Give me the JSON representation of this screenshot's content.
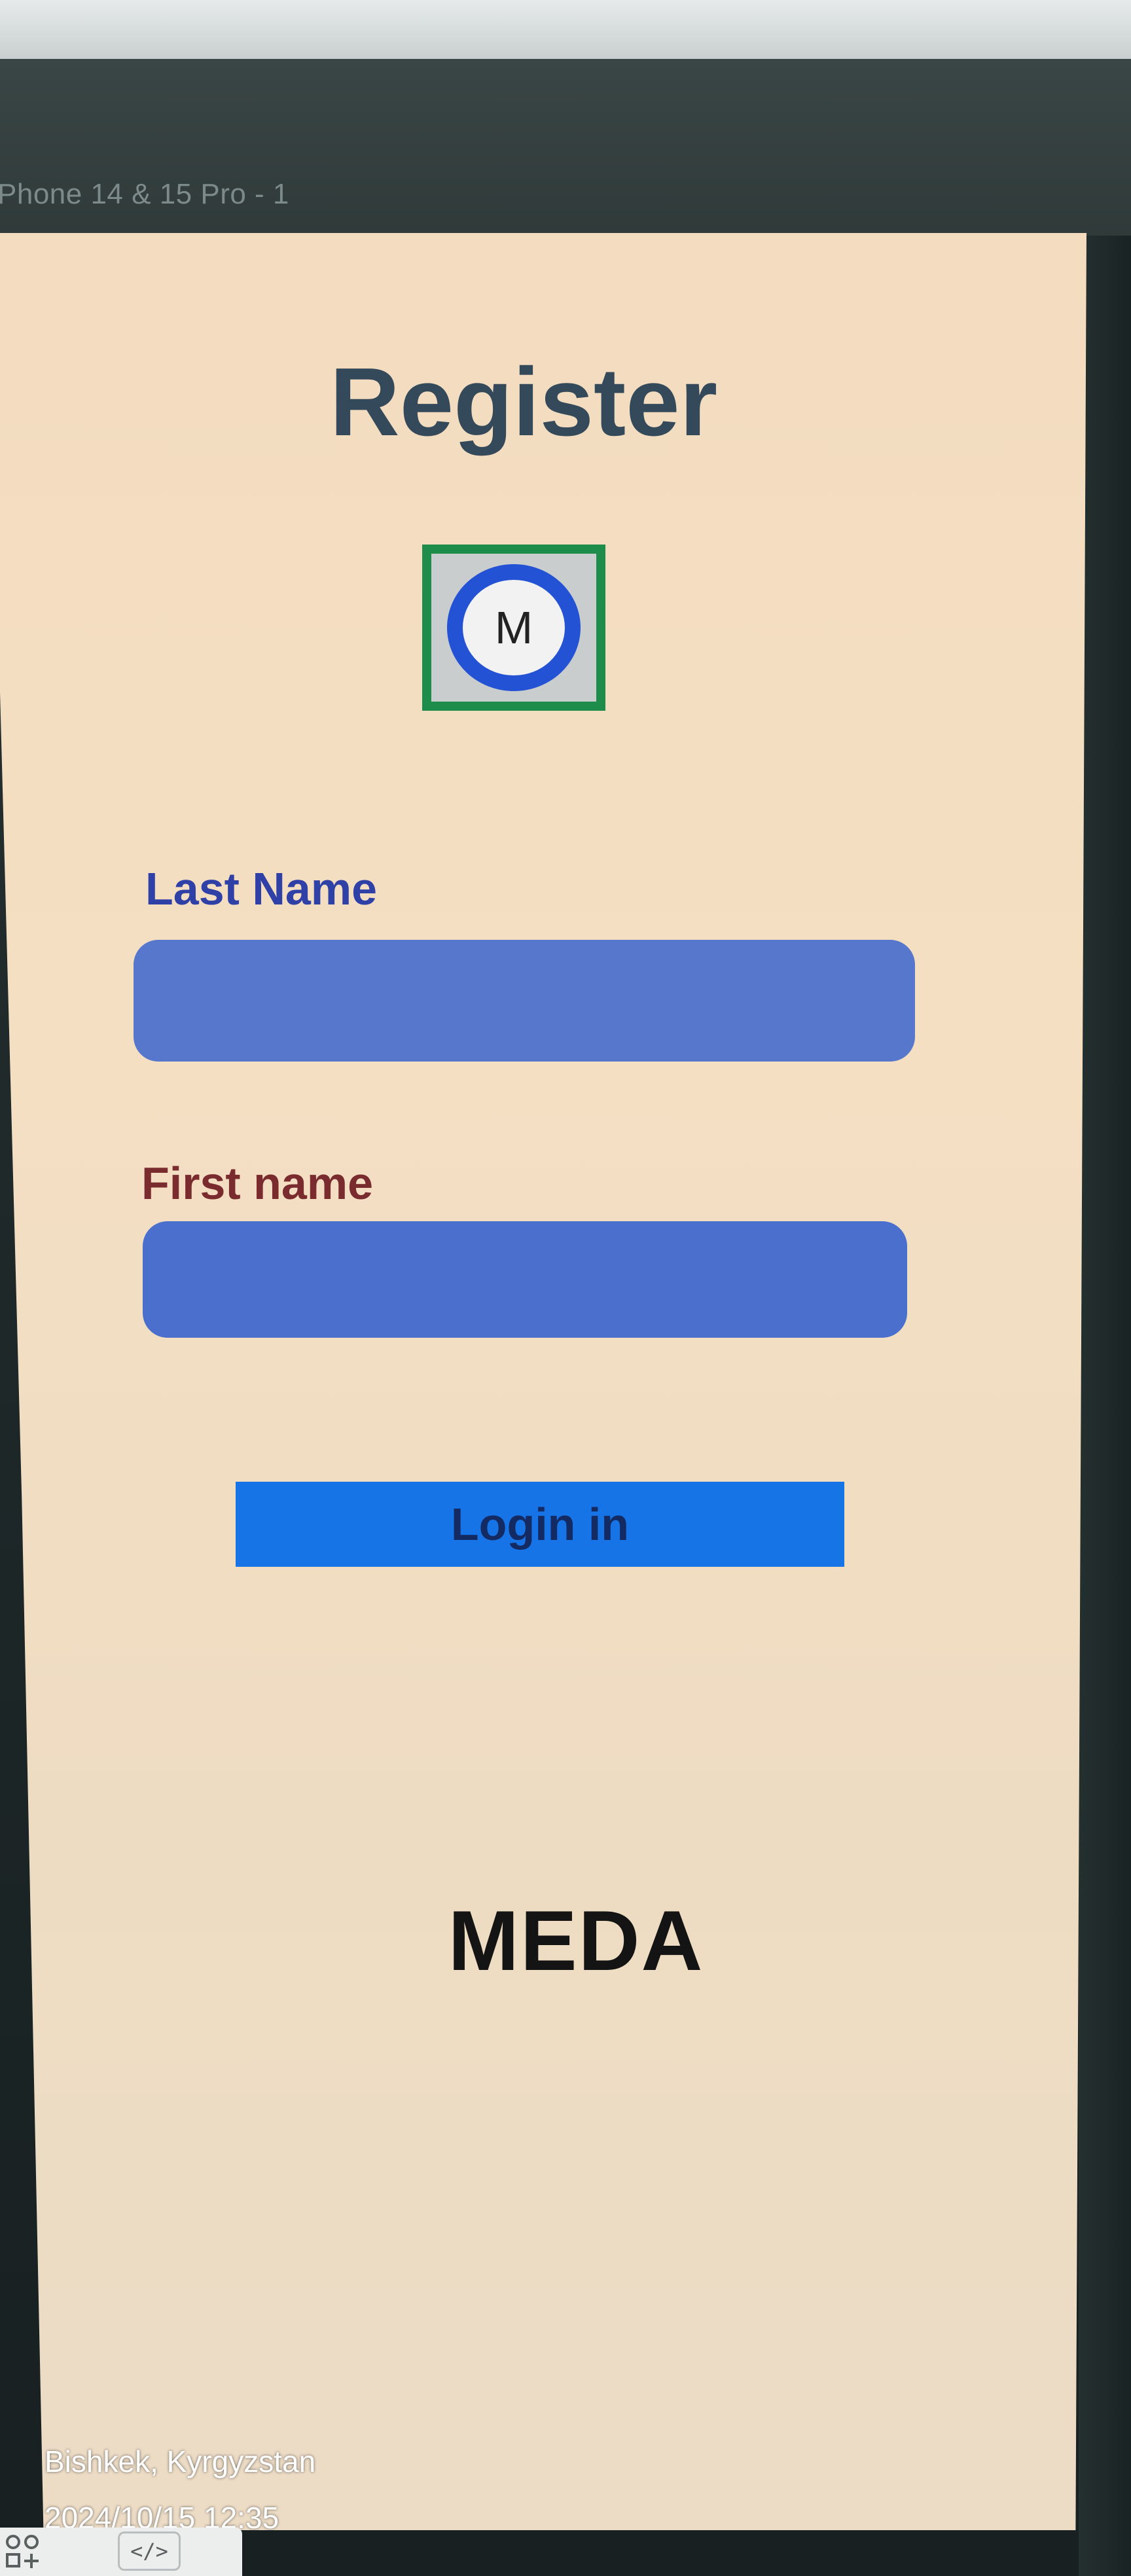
{
  "editor": {
    "frame_label": "Phone 14 & 15 Pro - 1",
    "toolbar": {
      "components_icon": "components-icon",
      "code_icon": "code-icon",
      "code_glyph": "</>"
    }
  },
  "screen": {
    "title": "Register",
    "logo": {
      "letter": "M",
      "ring_color": "#2353d4",
      "frame_color": "#1e8c4a"
    },
    "form": {
      "last_name_label": "Last Name",
      "last_name_value": "",
      "first_name_label": "First name",
      "first_name_value": ""
    },
    "login_button_label": "Login in",
    "brand": "MEDA"
  },
  "photo_stamp": {
    "location": "Bishkek, Kyrgyzstan",
    "datetime": "2024/10/15 12:35"
  },
  "colors": {
    "background": "#f3dcc0",
    "title": "#34495a",
    "label_last": "#2f40a6",
    "label_first": "#7a2b2e",
    "button": "#1774e6"
  }
}
